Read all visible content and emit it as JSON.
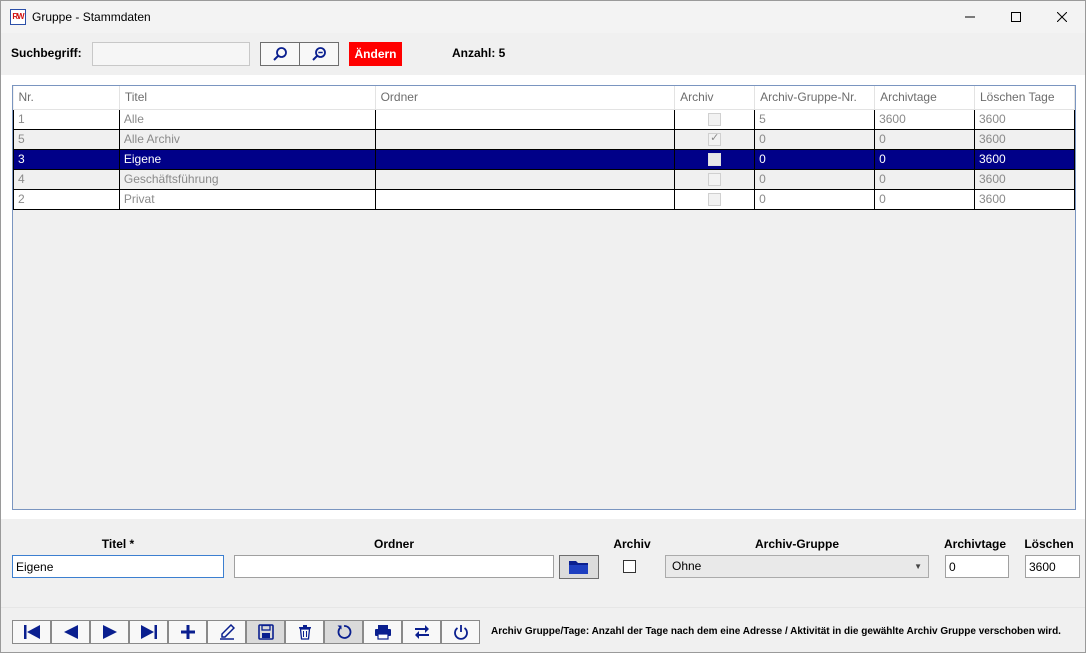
{
  "window": {
    "app_icon_text": "RW",
    "title": "Gruppe - Stammdaten"
  },
  "search": {
    "label": "Suchbegriff:",
    "value": "",
    "change_button": "Ändern",
    "count_label": "Anzahl: 5"
  },
  "table": {
    "columns": [
      "Nr.",
      "Titel",
      "Ordner",
      "Archiv",
      "Archiv-Gruppe-Nr.",
      "Archivtage",
      "Löschen Tage"
    ],
    "rows": [
      {
        "nr": "1",
        "titel": "Alle",
        "ordner": "",
        "archiv": false,
        "gruppe_nr": "5",
        "archivtage": "3600",
        "loeschen": "3600"
      },
      {
        "nr": "5",
        "titel": "Alle Archiv",
        "ordner": "",
        "archiv": true,
        "gruppe_nr": "0",
        "archivtage": "0",
        "loeschen": "3600"
      },
      {
        "nr": "3",
        "titel": "Eigene",
        "ordner": "",
        "archiv": false,
        "gruppe_nr": "0",
        "archivtage": "0",
        "loeschen": "3600",
        "selected": true
      },
      {
        "nr": "4",
        "titel": "Geschäftsführung",
        "ordner": "",
        "archiv": false,
        "gruppe_nr": "0",
        "archivtage": "0",
        "loeschen": "3600"
      },
      {
        "nr": "2",
        "titel": "Privat",
        "ordner": "",
        "archiv": false,
        "gruppe_nr": "0",
        "archivtage": "0",
        "loeschen": "3600"
      }
    ]
  },
  "form": {
    "titel_label": "Titel *",
    "titel_value": "Eigene",
    "ordner_label": "Ordner",
    "ordner_value": "",
    "archiv_label": "Archiv",
    "archiv_checked": false,
    "archiv_gruppe_label": "Archiv-Gruppe",
    "archiv_gruppe_value": "Ohne",
    "archivtage_label": "Archivtage",
    "archivtage_value": "0",
    "loeschen_label": "Löschen",
    "loeschen_value": "3600"
  },
  "toolbar": {
    "buttons": [
      "first-record-icon",
      "previous-record-icon",
      "next-record-icon",
      "last-record-icon",
      "add-icon",
      "edit-icon",
      "save-icon",
      "delete-icon",
      "refresh-icon",
      "print-icon",
      "swap-icon",
      "power-icon"
    ],
    "info": "Archiv Gruppe/Tage: Anzahl der Tage nach dem eine Adresse / Aktivität in die gewählte Archiv Gruppe verschoben wird."
  },
  "colors": {
    "selection": "#000088",
    "change_button": "#ff0000",
    "icon_blue": "#0a1f8f"
  }
}
